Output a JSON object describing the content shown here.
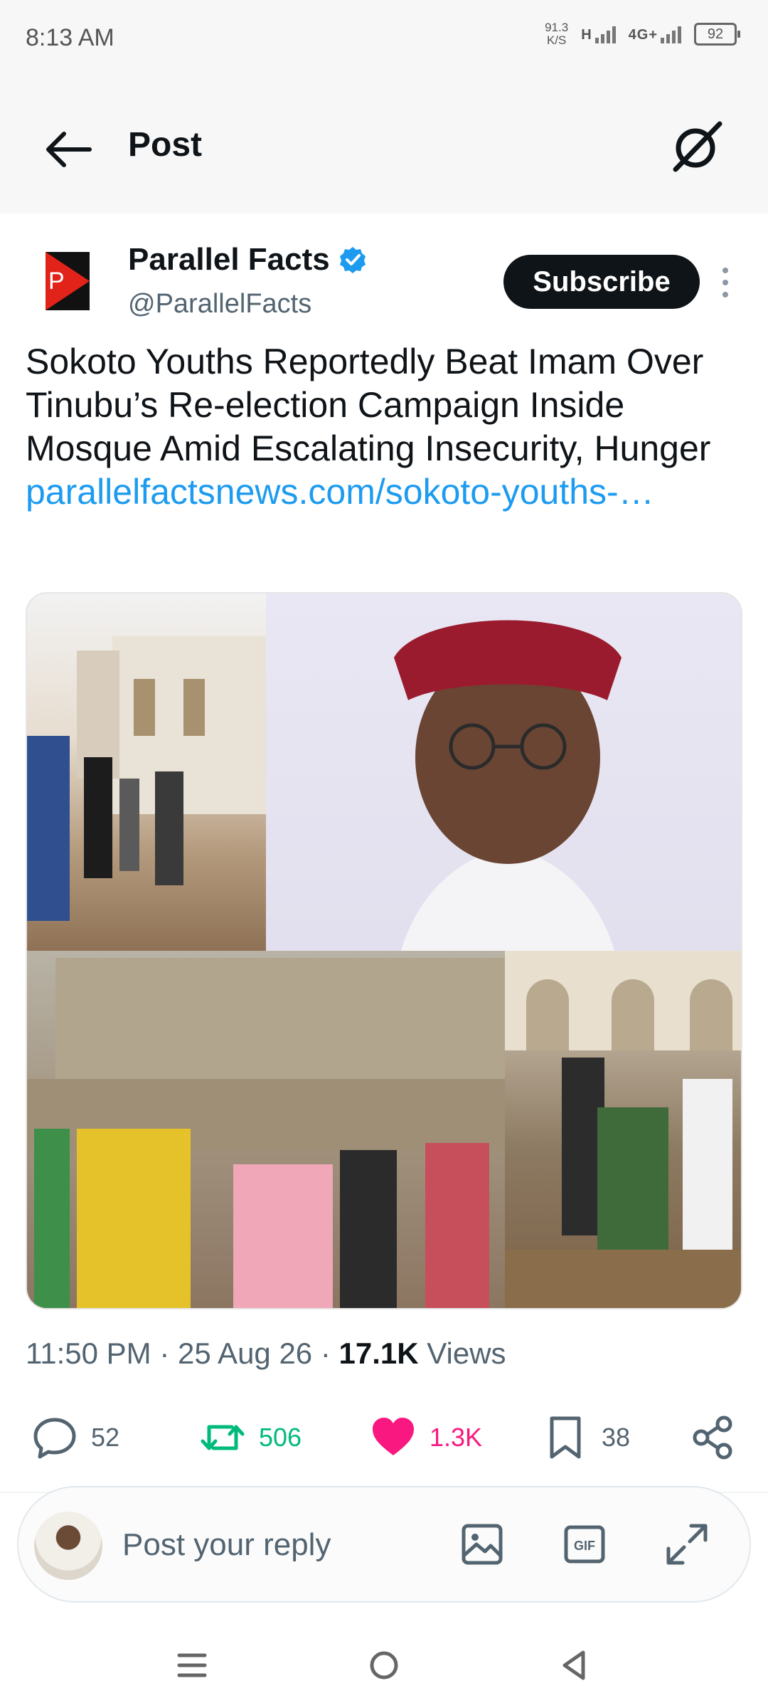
{
  "status_bar": {
    "time": "8:13 AM",
    "net_speed_value": "91.3",
    "net_speed_unit": "K/S",
    "signal_label_1": "H",
    "signal_label_2": "4G+",
    "battery": "92"
  },
  "header": {
    "title": "Post",
    "back_icon": "arrow-left-icon",
    "right_icon": "grok-icon"
  },
  "author": {
    "name": "Parallel Facts",
    "handle": "@ParallelFacts",
    "verified": true,
    "subscribe_label": "Subscribe"
  },
  "post": {
    "text": "Sokoto Youths Reportedly Beat Imam Over Tinubu’s Re-election Campaign Inside Mosque Amid Escalating Insecurity, Hunger ",
    "link_text": "parallelfactsnews.com/sokoto-youths-…",
    "media_count": 4
  },
  "meta": {
    "time": "11:50 PM",
    "sep1": " · ",
    "date": "25 Aug 26",
    "sep2": " · ",
    "views_count": "17.1K",
    "views_label": " Views"
  },
  "actions": {
    "replies": "52",
    "reposts": "506",
    "likes": "1.3K",
    "bookmarks": "38"
  },
  "reply_bar": {
    "placeholder": "Post your reply"
  },
  "colors": {
    "accent": "#1d9bf0",
    "repost": "#00ba7c",
    "like": "#f91880",
    "text": "#0f1419",
    "muted": "#536471"
  }
}
